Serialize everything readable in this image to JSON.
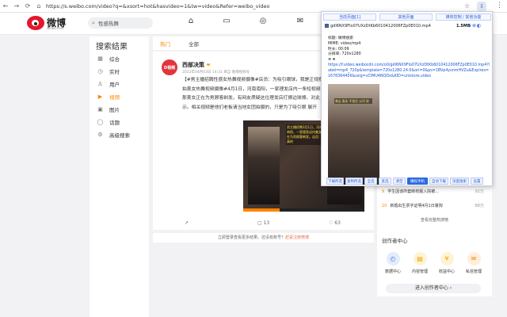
{
  "browser": {
    "url": "https://s.weibo.com/video?q=&xsort=hot&hasvideo=1&tw=video&Refer=weibo_video",
    "back": "←",
    "forward": "→",
    "reload": "C",
    "home": "⌂"
  },
  "header": {
    "logo_text": "微博",
    "logo_sub": "weibo.com",
    "search_placeholder": "性感热舞"
  },
  "left": {
    "title": "搜索结果",
    "items": [
      {
        "label": "综合",
        "icon": "▦"
      },
      {
        "label": "实时",
        "icon": "◷"
      },
      {
        "label": "用户",
        "icon": "♙"
      },
      {
        "label": "视频",
        "icon": "▶"
      },
      {
        "label": "图片",
        "icon": "▣"
      },
      {
        "label": "话题",
        "icon": "◯"
      },
      {
        "label": "高级搜索",
        "icon": "⚙"
      }
    ]
  },
  "tabs": [
    "热门",
    "全部"
  ],
  "post": {
    "avatar": "D视频",
    "author": "西部决策",
    "vip": "❤",
    "meta": "2022年04月03日 14:31 来自 微博视频号",
    "lines": [
      "【#男主播招聘性感女热舞视频摄像#店员：为吸引眼球，我是正规摆",
      "拍美女热舞视频摄像#4月1日，河南南阳，一家理发店内一条短视频",
      "那美女正在为男顾客剃发。有网友质疑这位理发店打擦边球擦。对此，",
      "示。相关视频是他们老板请当地女团拍摄的，只是为了吸引眼 展开"
    ],
    "video_caption": "男主播招聘3月1日，河南南阳，一家理发店内美女正在为男顾客剃发。店员：是真的",
    "actions": {
      "share": "↗",
      "comments": "13",
      "likes": "63"
    }
  },
  "login_bar": {
    "text": "立即登录查看更多结果。还没有账号？",
    "link": "赶紧注册微博"
  },
  "hot": [
    {
      "no": "9",
      "text": "学生因该所套断校服入院被...",
      "count": "92万"
    },
    {
      "no": "10",
      "text": "新婚出生票字证明4月1日暴狗",
      "count": "88万"
    }
  ],
  "hot_more": "查看完整热搜榜",
  "creator": {
    "title": "创作者中心",
    "items": [
      {
        "label": "数据中心",
        "icon": "◴",
        "color": "#4a7bd8",
        "bg": "#e4ecfb"
      },
      {
        "label": "内容管理",
        "icon": "▤",
        "color": "#f2a100",
        "bg": "#fff3d6"
      },
      {
        "label": "收益中心",
        "icon": "¥",
        "color": "#f2a100",
        "bg": "#fff3d6"
      },
      {
        "label": "私信管理",
        "icon": "✉",
        "color": "#f08a00",
        "bg": "#ffeede"
      }
    ],
    "enter": "进入创作者中心 ›"
  },
  "panel": {
    "tabs": [
      "当前页面[1]",
      "其他页面",
      "媒体控制 / 其他功能"
    ],
    "filename": "gdl6NX9Flo07UXzDtKb6010412006FZp0E010.mp4",
    "size": "1.5MB",
    "file_icons": "⊕⊗◐",
    "info_title": "标题: 微博搜索",
    "mime": "MIME: video/mp4",
    "duration": "时长: 00:09",
    "resolution": "分辨率: 720x1280",
    "url": "https://f.video.weibocdn.com/o0/gdl6NX9Flo07UXzDtKb6010412006FZp0E010.mp4?label=mp4_720p&template=720x1280.24.0&ori=0&ps=1BVp4ysnmHVZu&Expires=1678364456&ssig=vCIMU4NQDx&KID=unistore,video",
    "thumb_caption": "美女 真实 不良后 公司 剪",
    "buttons": [
      "下载所选",
      "复制所选",
      "全选",
      "反选",
      "清空",
      "横权手机",
      "自动下载",
      "深度搜索",
      "设置"
    ]
  }
}
